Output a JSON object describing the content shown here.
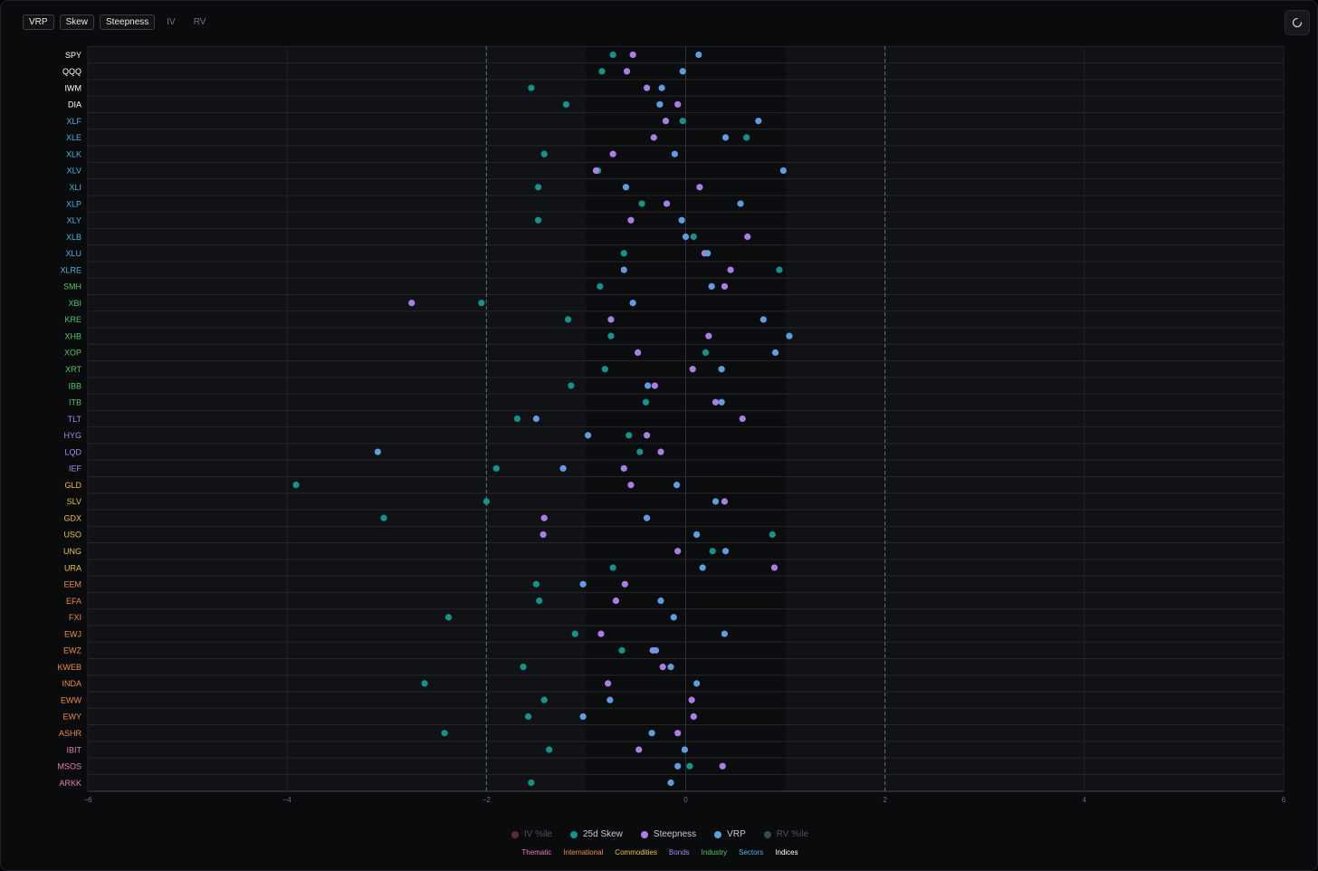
{
  "toolbar": {
    "buttons": [
      "VRP",
      "Skew",
      "Steepness"
    ],
    "plain_buttons": [
      "IV",
      "RV"
    ]
  },
  "refresh_icon": "refresh-icon",
  "legend": {
    "series": [
      {
        "label": "IV %ile",
        "color": "#5a2a33",
        "muted": true
      },
      {
        "label": "25d Skew",
        "color": "#14938a",
        "muted": false
      },
      {
        "label": "Steepness",
        "color": "#a97fe6",
        "muted": false
      },
      {
        "label": "VRP",
        "color": "#5f9de0",
        "muted": false
      },
      {
        "label": "RV %ile",
        "color": "#2d4d4a",
        "muted": true
      }
    ],
    "groups": [
      {
        "label": "Thematic",
        "color": "#e77fb5"
      },
      {
        "label": "International",
        "color": "#ee8a45"
      },
      {
        "label": "Commodities",
        "color": "#e6c23a"
      },
      {
        "label": "Bonds",
        "color": "#a688ee"
      },
      {
        "label": "Industry",
        "color": "#56c46a"
      },
      {
        "label": "Sectors",
        "color": "#4fb0e0"
      },
      {
        "label": "Indices",
        "color": "#ffffff"
      }
    ]
  },
  "chart_data": {
    "type": "scatter",
    "xlim": [
      -6,
      6
    ],
    "xticks": [
      -6,
      -4,
      -2,
      0,
      2,
      4,
      6
    ],
    "reference_lines": [
      -2,
      2
    ],
    "shaded_band": [
      -1,
      1
    ],
    "tickers": [
      {
        "name": "SPY",
        "group": "Indices",
        "skew": -0.73,
        "steep": -0.53,
        "vrp": 0.13
      },
      {
        "name": "QQQ",
        "group": "Indices",
        "skew": -0.84,
        "steep": -0.59,
        "vrp": -0.03
      },
      {
        "name": "IWM",
        "group": "Indices",
        "skew": -1.55,
        "steep": -0.39,
        "vrp": -0.24
      },
      {
        "name": "DIA",
        "group": "Indices",
        "skew": -1.2,
        "steep": -0.08,
        "vrp": -0.26
      },
      {
        "name": "XLF",
        "group": "Sectors",
        "skew": -0.03,
        "steep": -0.2,
        "vrp": 0.73
      },
      {
        "name": "XLE",
        "group": "Sectors",
        "skew": 0.61,
        "steep": -0.32,
        "vrp": 0.4
      },
      {
        "name": "XLK",
        "group": "Sectors",
        "skew": -1.42,
        "steep": -0.73,
        "vrp": -0.11
      },
      {
        "name": "XLV",
        "group": "Sectors",
        "skew": -0.88,
        "steep": -0.9,
        "vrp": 0.98
      },
      {
        "name": "XLI",
        "group": "Sectors",
        "skew": -1.48,
        "steep": 0.14,
        "vrp": -0.6
      },
      {
        "name": "XLP",
        "group": "Sectors",
        "skew": -0.44,
        "steep": -0.19,
        "vrp": 0.55
      },
      {
        "name": "XLY",
        "group": "Sectors",
        "skew": -1.48,
        "steep": -0.55,
        "vrp": -0.04
      },
      {
        "name": "XLB",
        "group": "Sectors",
        "skew": 0.08,
        "steep": 0.62,
        "vrp": 0.0
      },
      {
        "name": "XLU",
        "group": "Sectors",
        "skew": -0.62,
        "steep": 0.19,
        "vrp": 0.22
      },
      {
        "name": "XLRE",
        "group": "Sectors",
        "skew": 0.94,
        "steep": 0.45,
        "vrp": -0.62
      },
      {
        "name": "SMH",
        "group": "Industry",
        "skew": -0.86,
        "steep": 0.39,
        "vrp": 0.26
      },
      {
        "name": "XBI",
        "group": "Industry",
        "skew": -2.05,
        "steep": -2.75,
        "vrp": -0.53
      },
      {
        "name": "KRE",
        "group": "Industry",
        "skew": -1.18,
        "steep": -0.75,
        "vrp": 0.78
      },
      {
        "name": "XHB",
        "group": "Industry",
        "skew": -0.75,
        "steep": 0.23,
        "vrp": 1.04
      },
      {
        "name": "XOP",
        "group": "Industry",
        "skew": 0.2,
        "steep": -0.48,
        "vrp": 0.9
      },
      {
        "name": "XRT",
        "group": "Industry",
        "skew": -0.81,
        "steep": 0.07,
        "vrp": 0.36
      },
      {
        "name": "IBB",
        "group": "Industry",
        "skew": -1.15,
        "steep": -0.31,
        "vrp": -0.38
      },
      {
        "name": "ITB",
        "group": "Industry",
        "skew": -0.4,
        "steep": 0.3,
        "vrp": 0.36
      },
      {
        "name": "TLT",
        "group": "Bonds",
        "skew": -1.69,
        "steep": 0.57,
        "vrp": -1.5
      },
      {
        "name": "HYG",
        "group": "Bonds",
        "skew": -0.57,
        "steep": -0.39,
        "vrp": -0.98
      },
      {
        "name": "LQD",
        "group": "Bonds",
        "skew": -0.46,
        "steep": -0.25,
        "vrp": -3.09
      },
      {
        "name": "IEF",
        "group": "Bonds",
        "skew": -1.9,
        "steep": -0.62,
        "vrp": -1.23
      },
      {
        "name": "GLD",
        "group": "Commodities",
        "skew": -3.91,
        "steep": -0.55,
        "vrp": -0.09
      },
      {
        "name": "SLV",
        "group": "Commodities",
        "skew": -2.0,
        "steep": 0.39,
        "vrp": 0.3
      },
      {
        "name": "GDX",
        "group": "Commodities",
        "skew": -3.03,
        "steep": -1.42,
        "vrp": -0.39
      },
      {
        "name": "USO",
        "group": "Commodities",
        "skew": 0.87,
        "steep": -1.43,
        "vrp": 0.11
      },
      {
        "name": "UNG",
        "group": "Commodities",
        "skew": 0.27,
        "steep": -0.08,
        "vrp": 0.4
      },
      {
        "name": "URA",
        "group": "Commodities",
        "skew": -0.73,
        "steep": 0.89,
        "vrp": 0.17
      },
      {
        "name": "EEM",
        "group": "International",
        "skew": -1.5,
        "steep": -0.61,
        "vrp": -1.03
      },
      {
        "name": "EFA",
        "group": "International",
        "skew": -1.47,
        "steep": -0.7,
        "vrp": -0.25
      },
      {
        "name": "FXI",
        "group": "International",
        "skew": -2.38,
        "steep": null,
        "vrp": -0.12
      },
      {
        "name": "EWJ",
        "group": "International",
        "skew": -1.11,
        "steep": -0.85,
        "vrp": 0.39
      },
      {
        "name": "EWZ",
        "group": "International",
        "skew": -0.64,
        "steep": -0.33,
        "vrp": -0.3
      },
      {
        "name": "KWEB",
        "group": "International",
        "skew": -1.63,
        "steep": -0.23,
        "vrp": -0.15
      },
      {
        "name": "INDA",
        "group": "International",
        "skew": -2.62,
        "steep": -0.78,
        "vrp": 0.11
      },
      {
        "name": "EWW",
        "group": "International",
        "skew": -1.42,
        "steep": 0.06,
        "vrp": -0.76
      },
      {
        "name": "EWY",
        "group": "International",
        "skew": -1.58,
        "steep": 0.08,
        "vrp": -1.03
      },
      {
        "name": "ASHR",
        "group": "International",
        "skew": -2.42,
        "steep": -0.08,
        "vrp": -0.34
      },
      {
        "name": "IBIT",
        "group": "Thematic",
        "skew": -1.37,
        "steep": -0.47,
        "vrp": -0.01
      },
      {
        "name": "MSOS",
        "group": "Thematic",
        "skew": 0.04,
        "steep": 0.37,
        "vrp": -0.08
      },
      {
        "name": "ARKK",
        "group": "Thematic",
        "skew": -1.55,
        "steep": null,
        "vrp": -0.15
      }
    ]
  }
}
